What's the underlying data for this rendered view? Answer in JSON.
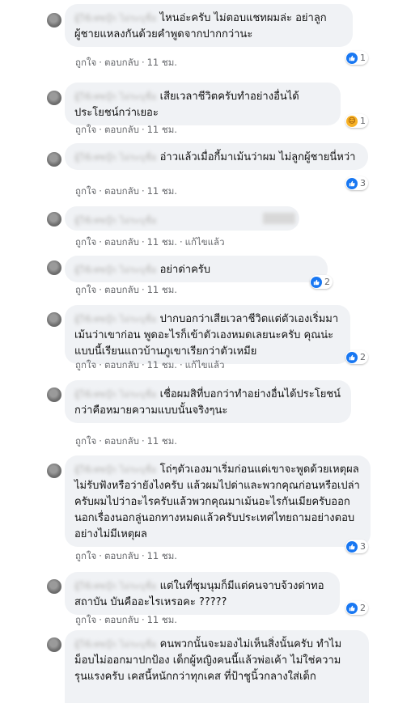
{
  "actions": {
    "like": "ถูกใจ",
    "reply": "ตอบกลับ",
    "edited": "แก้ไขแล้ว"
  },
  "comments": [
    {
      "name": "ผู้ใช้เฟซบุ๊ก ไม่ระบุชื่อ",
      "text": "ไหนอ่ะครับ ไม่ตอบแชทผมล่ะ อย่าลูกผู้ชายแหลงกันด้วยคำพูดจากปากกว่านะ",
      "time": "11 ชม.",
      "reaction": {
        "icon": "like-icon",
        "count": "1"
      }
    },
    {
      "name": "ผู้ใช้เฟซบุ๊ก ไม่ระบุชื่อ",
      "text": "เสียเวลาชีวิตครับทำอย่างอื่นได้ประโยชน์กว่าเยอะ",
      "time": "11 ชม.",
      "reaction": {
        "icon": "haha-icon",
        "count": "1"
      }
    },
    {
      "name": "ผู้ใช้เฟซบุ๊ก ไม่ระบุชื่อ",
      "text": "อ่าวแล้วเมื่อกี้มาเม้นว่าผม ไม่ลูกผู้ชายนี่หว่า",
      "time": "11 ชม.",
      "reaction": {
        "icon": "like-icon",
        "count": "3"
      }
    },
    {
      "name": "ผู้ใช้เฟซบุ๊ก ไม่ระบุชื่อ",
      "text": "",
      "time": "11 ชม.",
      "edited": true
    },
    {
      "name": "ผู้ใช้เฟซบุ๊ก ไม่ระบุชื่อ",
      "text": "อย่าด่าครับ",
      "time": "11 ชม.",
      "reaction": {
        "icon": "like-icon",
        "count": "2"
      }
    },
    {
      "name": "ผู้ใช้เฟซบุ๊ก ไม่ระบุชื่อ",
      "text": "ปากบอกว่าเสียเวลาชีวิตแต่ตัวเองเริ่มมาเม้นว่าเขาก่อน พูดอะไรก็เข้าตัวเองหมดเลยนะครับ คุณน่ะ แบบนี้เรียนแถวบ้านภูเขาเรียกว่าตัวเหมีย",
      "time": "11 ชม.",
      "edited": true,
      "reaction": {
        "icon": "like-icon",
        "count": "2"
      }
    },
    {
      "name": "ผู้ใช้เฟซบุ๊ก ไม่ระบุชื่อ",
      "text": "เชื่อผมสิที่บอกว่าทำอย่างอื่นได้ประโยชน์กว่าคือหมายความแบบนั้นจริงๆนะ",
      "time": "11 ชม."
    },
    {
      "name": "ผู้ใช้เฟซบุ๊ก ไม่ระบุชื่อ",
      "text": "โถ่ๆตัวเองมาเริ่มก่อนแต่เขาจะพูดด้วยเหตุผลไม่รับฟังหรือว่ายังไงครับ แล้วผมไปด่าและพวกคุณก่อนหรือเปล่าครับผมไปว่าอะไรครับแล้วพวกคุณมาเม้นอะไรกันเมียครับออกนอกเรื่องนอกลู่นอกทางหมดแล้วครับประเทศไทยถามอย่างตอบอย่างไม่มีเหตุผล",
      "time": "11 ชม.",
      "reaction": {
        "icon": "like-icon",
        "count": "3"
      }
    },
    {
      "name": "ผู้ใช้เฟซบุ๊ก ไม่ระบุชื่อ",
      "text": "แต่ในที่ชุมนุมก็มีแต่คนจาบจ้วงด่าทอสถาบัน บันคืออะไรเหรอคะ ?????",
      "time": "11 ชม.",
      "reaction": {
        "icon": "like-icon",
        "count": "2"
      }
    },
    {
      "name": "ผู้ใช้เฟซบุ๊ก ไม่ระบุชื่อ",
      "text": "คนพวกนั้นจะมองไม่เห็นสิ่งนั้นครับ ทำไมม็อบไม่ออกมาปกป้อง เด็กผู้หญิงคนนี้แล้วพ่อเค้า ไม่ใช่ความรุนแรงครับ เคสนี้หนักกว่าทุกเคส ที่ป้าชูนิ้วกลางใส่เด็ก",
      "time": ""
    }
  ]
}
